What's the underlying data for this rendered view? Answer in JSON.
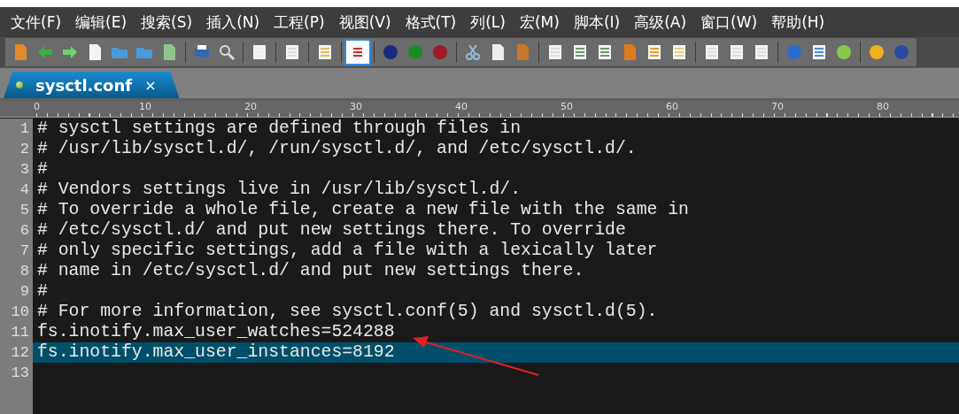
{
  "menu": [
    {
      "label": "文件(F)"
    },
    {
      "label": "编辑(E)"
    },
    {
      "label": "搜索(S)"
    },
    {
      "label": "插入(N)"
    },
    {
      "label": "工程(P)"
    },
    {
      "label": "视图(V)"
    },
    {
      "label": "格式(T)"
    },
    {
      "label": "列(L)"
    },
    {
      "label": "宏(M)"
    },
    {
      "label": "脚本(I)"
    },
    {
      "label": "高级(A)"
    },
    {
      "label": "窗口(W)"
    },
    {
      "label": "帮助(H)"
    }
  ],
  "tabs": [
    {
      "label": "sysctl.conf",
      "close": "×",
      "selected": true
    }
  ],
  "ruler": [
    "0",
    "10",
    "20",
    "30",
    "40",
    "50",
    "60",
    "70",
    "80"
  ],
  "lines": [
    {
      "number": "1",
      "text": "# sysctl settings are defined through files in",
      "selected": false
    },
    {
      "number": "2",
      "text": "# /usr/lib/sysctl.d/, /run/sysctl.d/, and /etc/sysctl.d/.",
      "selected": false
    },
    {
      "number": "3",
      "text": "#",
      "selected": false
    },
    {
      "number": "4",
      "text": "# Vendors settings live in /usr/lib/sysctl.d/.",
      "selected": false
    },
    {
      "number": "5",
      "text": "# To override a whole file, create a new file with the same in",
      "selected": false
    },
    {
      "number": "6",
      "text": "# /etc/sysctl.d/ and put new settings there. To override",
      "selected": false
    },
    {
      "number": "7",
      "text": "# only specific settings, add a file with a lexically later",
      "selected": false
    },
    {
      "number": "8",
      "text": "# name in /etc/sysctl.d/ and put new settings there.",
      "selected": false
    },
    {
      "number": "9",
      "text": "#",
      "selected": false
    },
    {
      "number": "10",
      "text": "# For more information, see sysctl.conf(5) and sysctl.d(5).",
      "selected": false
    },
    {
      "number": "11",
      "text": "fs.inotify.max_user_watches=524288",
      "selected": false
    },
    {
      "number": "12",
      "text": "fs.inotify.max_user_instances=8192",
      "selected": true
    },
    {
      "number": "13",
      "selected": false
    }
  ]
}
